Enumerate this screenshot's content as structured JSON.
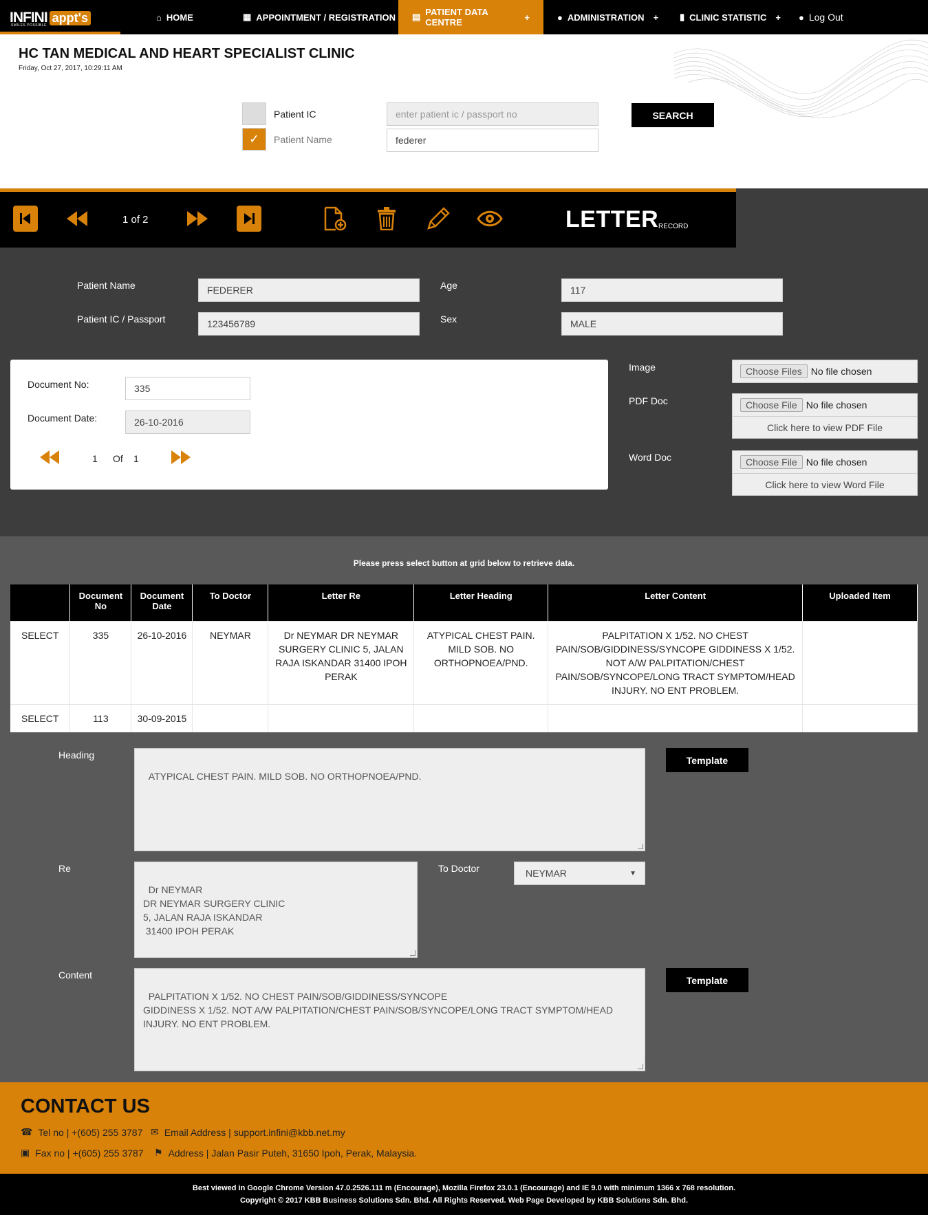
{
  "nav": {
    "items": [
      {
        "label": "HOME",
        "icon": "home-icon"
      },
      {
        "label": "APPOINTMENT / REGISTRATION",
        "icon": "calendar-icon"
      },
      {
        "label": "PATIENT DATA CENTRE",
        "icon": "document-icon"
      },
      {
        "label": "ADMINISTRATION",
        "icon": "user-icon"
      },
      {
        "label": "CLINIC STATISTIC",
        "icon": "bar-chart-icon"
      },
      {
        "label": "Log Out",
        "icon": "user-icon"
      }
    ],
    "plus": "+",
    "active_color": "#d9820a"
  },
  "logo": {
    "text_left": "INFINI",
    "text_right": "appt's",
    "tagline": "SMILES POSSIBLE"
  },
  "header": {
    "clinic_name": "HC TAN MEDICAL AND HEART SPECIALIST CLINIC",
    "datetime": "Friday, Oct 27, 2017, 10:29:11 AM"
  },
  "search": {
    "option_ic_label": "Patient IC",
    "option_name_label": "Patient Name",
    "ic_placeholder": "enter patient ic / passport no",
    "name_value": "federer",
    "button_label": "SEARCH",
    "check_mark": "✓"
  },
  "toolbar": {
    "pager": "1 of 2",
    "title": "LETTER",
    "subtitle": "RECORD"
  },
  "patient": {
    "name_label": "Patient Name",
    "name_value": "FEDERER",
    "ic_label": "Patient IC / Passport",
    "ic_value": "123456789",
    "age_label": "Age",
    "age_value": "117",
    "sex_label": "Sex",
    "sex_value": "MALE"
  },
  "document": {
    "no_label": "Document No:",
    "no_value": "335",
    "date_label": "Document Date:",
    "date_value": "26-10-2016",
    "page_current": "1",
    "page_of": "Of",
    "page_total": "1"
  },
  "files": {
    "image_label": "Image",
    "pdf_label": "PDF Doc",
    "word_label": "Word Doc",
    "choose_files": "Choose Files",
    "choose_file": "Choose File",
    "no_file": "No file chosen",
    "view_pdf": "Click here to view PDF File",
    "view_word": "Click here to view Word File"
  },
  "grid": {
    "hint": "Please press select button at grid below to retrieve data.",
    "headers": [
      "",
      "Document No",
      "Document Date",
      "To Doctor",
      "Letter Re",
      "Letter Heading",
      "Letter Content",
      "Uploaded Item"
    ],
    "rows": [
      {
        "select": "SELECT",
        "doc_no": "335",
        "doc_date": "26-10-2016",
        "to_doctor": "NEYMAR",
        "letter_re": "Dr NEYMAR DR NEYMAR SURGERY CLINIC 5, JALAN RAJA ISKANDAR 31400 IPOH PERAK",
        "letter_heading": "ATYPICAL CHEST PAIN. MILD SOB. NO ORTHOPNOEA/PND.",
        "letter_content": "PALPITATION X 1/52. NO CHEST PAIN/SOB/GIDDINESS/SYNCOPE GIDDINESS X 1/52. NOT A/W PALPITATION/CHEST PAIN/SOB/SYNCOPE/LONG TRACT SYMPTOM/HEAD INJURY. NO ENT PROBLEM.",
        "uploaded": ""
      },
      {
        "select": "SELECT",
        "doc_no": "113",
        "doc_date": "30-09-2015",
        "to_doctor": "",
        "letter_re": "",
        "letter_heading": "",
        "letter_content": "",
        "uploaded": ""
      }
    ]
  },
  "form": {
    "heading_label": "Heading",
    "heading_value": "ATYPICAL CHEST PAIN. MILD SOB. NO ORTHOPNOEA/PND.",
    "template_label": "Template",
    "re_label": "Re",
    "re_value": "Dr NEYMAR\nDR NEYMAR SURGERY CLINIC\n5, JALAN RAJA ISKANDAR\n 31400 IPOH PERAK",
    "to_doctor_label": "To Doctor",
    "to_doctor_value": "NEYMAR",
    "content_label": "Content",
    "content_value": "PALPITATION X 1/52. NO CHEST PAIN/SOB/GIDDINESS/SYNCOPE\nGIDDINESS X 1/52. NOT A/W PALPITATION/CHEST PAIN/SOB/SYNCOPE/LONG TRACT SYMPTOM/HEAD INJURY. NO ENT PROBLEM."
  },
  "contact": {
    "title": "CONTACT US",
    "tel": "Tel no | +(605) 255 3787",
    "email": "Email Address | support.infini@kbb.net.my",
    "fax": "Fax no | +(605) 255 3787",
    "address": "Address | Jalan Pasir Puteh, 31650 Ipoh, Perak, Malaysia."
  },
  "footer": {
    "line1": "Best viewed in Google Chrome Version 47.0.2526.111 m (Encourage), Mozilla Firefox 23.0.1 (Encourage) and IE 9.0 with minimum 1366 x 768 resolution.",
    "line2": "Copyright © 2017 KBB Business Solutions Sdn. Bhd. All Rights Reserved. Web Page Developed by KBB Solutions Sdn. Bhd."
  }
}
